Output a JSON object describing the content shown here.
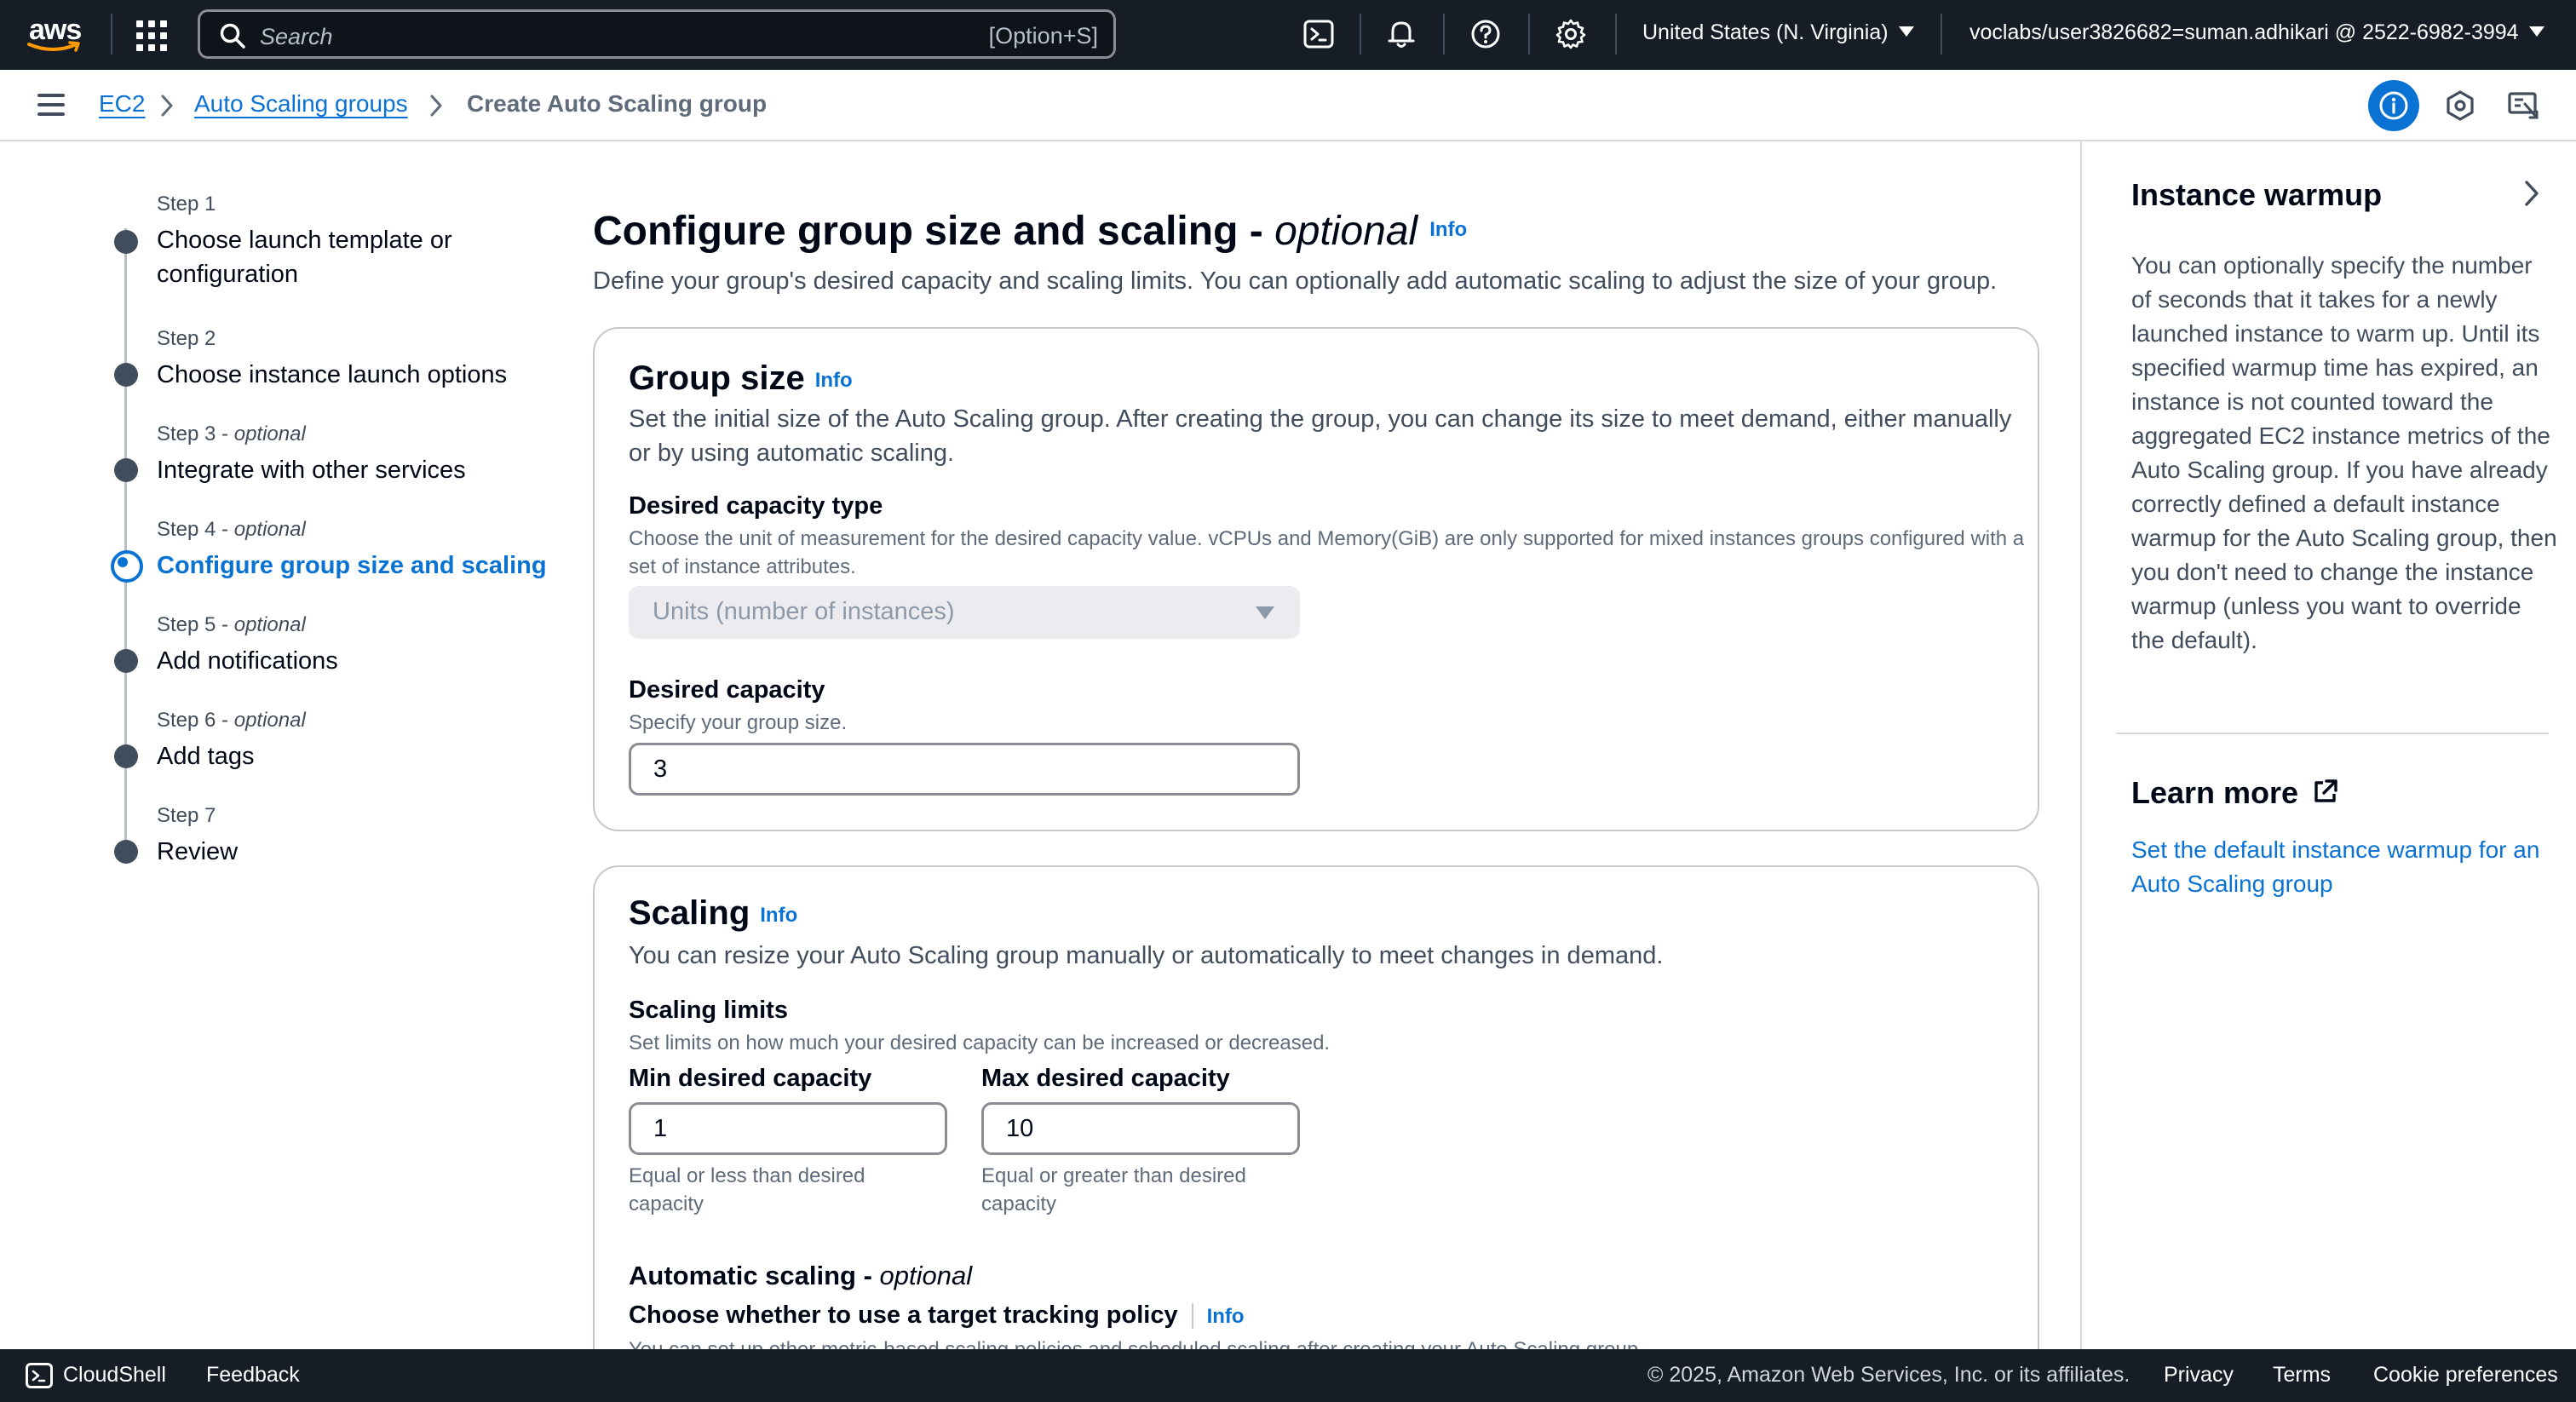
{
  "topnav": {
    "logo_text": "aws",
    "search_placeholder": "Search",
    "search_shortcut": "[Option+S]",
    "region": "United States (N. Virginia)",
    "account": "voclabs/user3826682=suman.adhikari @ 2522-6982-3994"
  },
  "breadcrumb": {
    "items": [
      "EC2",
      "Auto Scaling groups",
      "Create Auto Scaling group"
    ]
  },
  "steps": [
    {
      "num": "Step 1",
      "optional": "",
      "label": "Choose launch template or configuration"
    },
    {
      "num": "Step 2",
      "optional": "",
      "label": "Choose instance launch options"
    },
    {
      "num": "Step 3",
      "optional": "optional",
      "label": "Integrate with other services"
    },
    {
      "num": "Step 4",
      "optional": "optional",
      "label": "Configure group size and scaling"
    },
    {
      "num": "Step 5",
      "optional": "optional",
      "label": "Add notifications"
    },
    {
      "num": "Step 6",
      "optional": "optional",
      "label": "Add tags"
    },
    {
      "num": "Step 7",
      "optional": "",
      "label": "Review"
    }
  ],
  "main": {
    "title": "Configure group size and scaling - ",
    "title_optional": "optional",
    "info": "Info",
    "description": "Define your group's desired capacity and scaling limits. You can optionally add automatic scaling to adjust the size of your group."
  },
  "group_size": {
    "heading": "Group size",
    "info": "Info",
    "description": "Set the initial size of the Auto Scaling group. After creating the group, you can change its size to meet demand, either manually or by using automatic scaling.",
    "capacity_type_label": "Desired capacity type",
    "capacity_type_desc": "Choose the unit of measurement for the desired capacity value. vCPUs and Memory(GiB) are only supported for mixed instances groups configured with a set of instance attributes.",
    "capacity_type_value": "Units (number of instances)",
    "desired_capacity_label": "Desired capacity",
    "desired_capacity_desc": "Specify your group size.",
    "desired_capacity_value": "3"
  },
  "scaling": {
    "heading": "Scaling",
    "info": "Info",
    "description": "You can resize your Auto Scaling group manually or automatically to meet changes in demand.",
    "limits_label": "Scaling limits",
    "limits_desc": "Set limits on how much your desired capacity can be increased or decreased.",
    "min_label": "Min desired capacity",
    "min_value": "1",
    "min_hint": "Equal or less than desired capacity",
    "max_label": "Max desired capacity",
    "max_value": "10",
    "max_hint": "Equal or greater than desired capacity",
    "auto_label": "Automatic scaling - ",
    "auto_optional": "optional",
    "target_label": "Choose whether to use a target tracking policy",
    "target_info": "Info",
    "target_desc": "You can set up other metric-based scaling policies and scheduled scaling after creating your Auto Scaling group."
  },
  "help_panel": {
    "title": "Instance warmup",
    "body": "You can optionally specify the number of seconds that it takes for a newly launched instance to warm up. Until its specified warmup time has expired, an instance is not counted toward the aggregated EC2 instance metrics of the Auto Scaling group. If you have already correctly defined a default instance warmup for the Auto Scaling group, then you don't need to change the instance warmup (unless you want to override the default).",
    "learn_more": "Learn more",
    "link": "Set the default instance warmup for an Auto Scaling group"
  },
  "footer": {
    "cloudshell": "CloudShell",
    "feedback": "Feedback",
    "copyright": "© 2025, Amazon Web Services, Inc. or its affiliates.",
    "privacy": "Privacy",
    "terms": "Terms",
    "cookie": "Cookie preferences"
  },
  "colors": {
    "nav_bg": "#161d26",
    "accent": "#0972d3",
    "text": "#000716"
  }
}
